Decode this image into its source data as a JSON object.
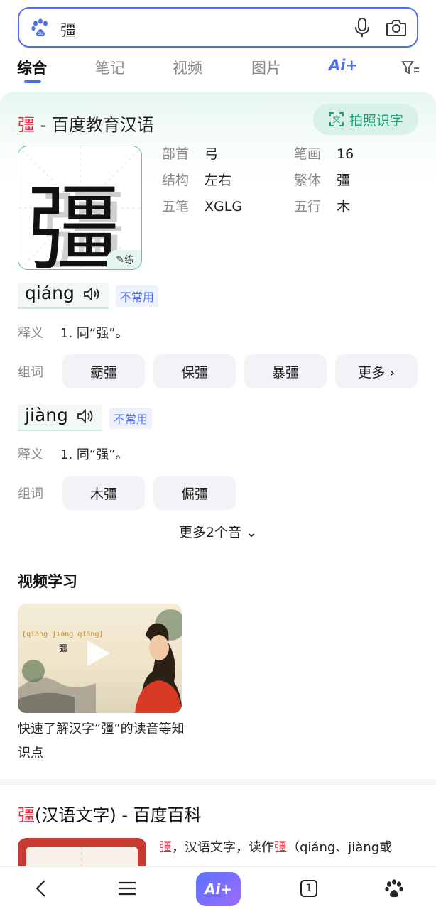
{
  "search": {
    "query": "彊"
  },
  "tabs": [
    {
      "label": "综合"
    },
    {
      "label": "笔记"
    },
    {
      "label": "视频"
    },
    {
      "label": "图片"
    },
    {
      "label": "Ai+"
    }
  ],
  "dict_card": {
    "title_char": "彊",
    "title_rest": " - 百度教育汉语",
    "photo_button": "拍照识字",
    "character": "彊",
    "practice_label": "练",
    "info": [
      {
        "label": "部首",
        "value": "弓"
      },
      {
        "label": "笔画",
        "value": "16"
      },
      {
        "label": "结构",
        "value": "左右"
      },
      {
        "label": "繁体",
        "value": "彊"
      },
      {
        "label": "五笔",
        "value": "XGLG"
      },
      {
        "label": "五行",
        "value": "木"
      }
    ],
    "readings": [
      {
        "pinyin": "qiáng",
        "badge": "不常用",
        "def_label": "释义",
        "definition": "1. 同“强”。",
        "words_label": "组词",
        "words": [
          "霸彊",
          "保彊",
          "暴彊",
          "更多 ›"
        ]
      },
      {
        "pinyin": "jiàng",
        "badge": "不常用",
        "def_label": "释义",
        "definition": "1. 同“强”。",
        "words_label": "组词",
        "words": [
          "木彊",
          "倔彊"
        ]
      }
    ],
    "more_readings": "更多2个音 ⌄"
  },
  "video_section": {
    "title": "视频学习",
    "thumb_pinyin": "[qiáng.jiàng qiǎng]",
    "thumb_char": "彊",
    "caption": "快速了解汉字“彊”的读音等知识点"
  },
  "baike": {
    "title_char": "彊",
    "title_rest": "(汉语文字) - 百度百科",
    "text_char": "彊",
    "text_mid": "，汉语文字，读作",
    "text_char2": "彊",
    "text_rest": "（qiáng、jiàng或"
  },
  "bottom_nav": {
    "ai_label": "Ai+",
    "tab_count": "1"
  },
  "colors": {
    "accent": "#4e6ef2",
    "highlight": "#e8283c",
    "green": "#1ba37a"
  }
}
